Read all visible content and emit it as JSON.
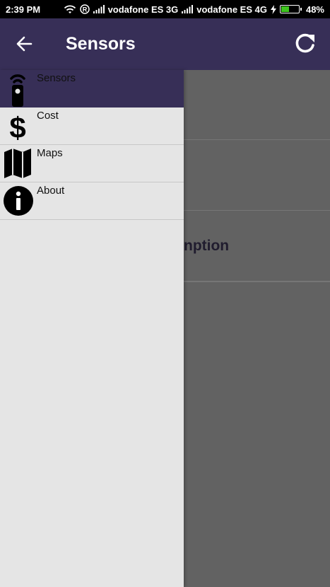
{
  "status_bar": {
    "time": "2:39 PM",
    "carrier1": "vodafone ES 3G",
    "carrier2": "vodafone ES 4G",
    "battery": "48%",
    "battery_level": 0.48,
    "battery_color": "#3ec31f",
    "icons": [
      "wifi-icon",
      "roaming-icon",
      "signal-icon",
      "signal-icon",
      "charging-icon",
      "battery-icon"
    ]
  },
  "app_bar": {
    "title": "Sensors",
    "back_icon": "arrow-left-icon",
    "refresh_icon": "refresh-icon",
    "color": "#372f57"
  },
  "drawer": {
    "items": [
      {
        "label": "Sensors",
        "icon": "sensor-remote-icon",
        "active": true
      },
      {
        "label": "Cost",
        "icon": "dollar-icon",
        "active": false
      },
      {
        "label": "Maps",
        "icon": "map-icon",
        "active": false
      },
      {
        "label": "About",
        "icon": "info-icon",
        "active": false
      }
    ]
  },
  "content": {
    "partial_label": "nption"
  }
}
